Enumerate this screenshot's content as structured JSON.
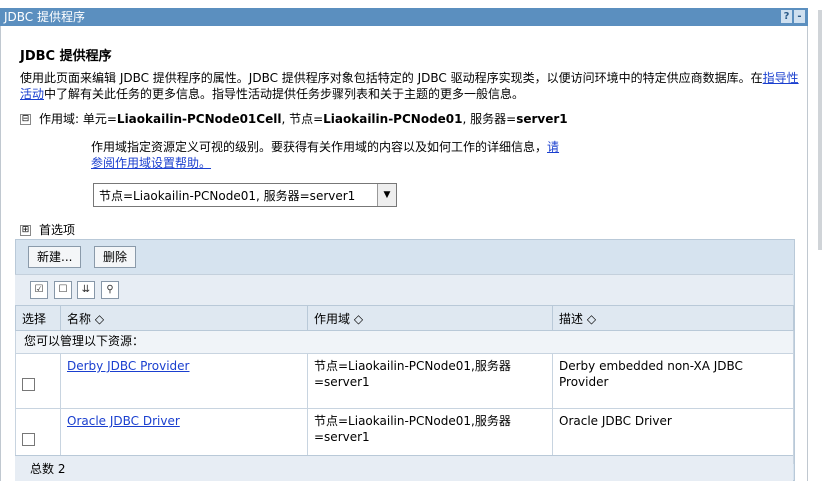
{
  "window": {
    "title": "JDBC 提供程序",
    "help_btn": "?",
    "min_btn": "-"
  },
  "page": {
    "heading": "JDBC 提供程序",
    "desc_before": "使用此页面来编辑 JDBC 提供程序的属性。JDBC 提供程序对象包括特定的 JDBC 驱动程序实现类，以便访问环境中的特定供应商数据库。在",
    "desc_link": "指导性活动",
    "desc_after": "中了解有关此任务的更多信息。指导性活动提供任务步骤列表和关于主题的更多一般信息。"
  },
  "scope": {
    "toggle": "⊟",
    "label": "作用域: 单元=",
    "cell": "Liaokailin-PCNode01Cell",
    "node_label": ", 节点=",
    "node": "Liaokailin-PCNode01",
    "server_label": ", 服务器=",
    "server": "server1",
    "help_text": "作用域指定资源定义可视的级别。要获得有关作用域的内容以及如何工作的详细信息，",
    "help_link": "请参阅作用域设置帮助。",
    "selected": "节点=Liaokailin-PCNode01, 服务器=server1",
    "arrow": "▼"
  },
  "preferences": {
    "toggle": "⊞",
    "label": "首选项"
  },
  "toolbar": {
    "new_label": "新建...",
    "delete_label": "删除"
  },
  "table": {
    "headers": [
      "选择",
      "名称 ◇",
      "作用域 ◇",
      "描述 ◇"
    ],
    "group_label": "您可以管理以下资源：",
    "rows": [
      {
        "name": "Derby JDBC Provider",
        "scope": "节点=Liaokailin-PCNode01,服务器=server1",
        "desc": "Derby embedded non-XA JDBC Provider"
      },
      {
        "name": "Oracle JDBC Driver",
        "scope": "节点=Liaokailin-PCNode01,服务器=server1",
        "desc": "Oracle JDBC Driver"
      }
    ],
    "total": "总数 2"
  }
}
